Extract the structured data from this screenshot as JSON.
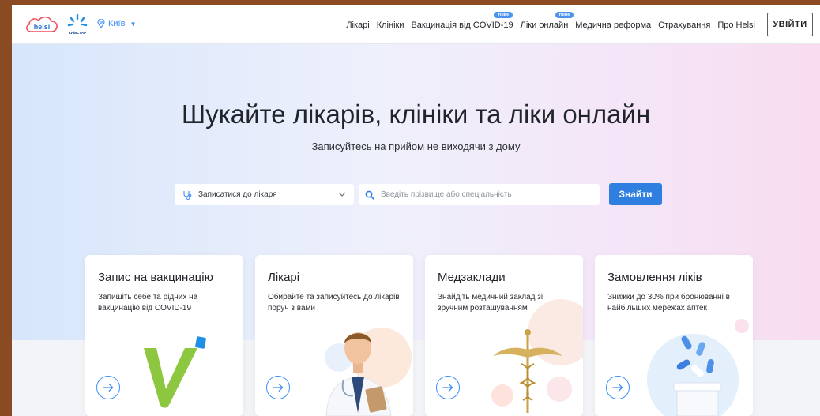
{
  "header": {
    "logo_text": "helsi",
    "partner_name": "КИЇВСТАР",
    "city": "Київ",
    "nav": [
      {
        "label": "Лікарі",
        "badge": ""
      },
      {
        "label": "Клініки",
        "badge": ""
      },
      {
        "label": "Вакцинація від COVID-19",
        "badge": "Нове"
      },
      {
        "label": "Ліки онлайн",
        "badge": "Нове"
      },
      {
        "label": "Медична реформа",
        "badge": ""
      },
      {
        "label": "Страхування",
        "badge": ""
      },
      {
        "label": "Про Helsi",
        "badge": ""
      }
    ],
    "login_label": "УВІЙТИ"
  },
  "hero": {
    "title": "Шукайте лікарів, клініки та ліки онлайн",
    "subtitle": "Записуйтесь на прийом не виходячи з дому"
  },
  "search": {
    "select_value": "Записатися до лікаря",
    "placeholder": "Введіть прізвище або спеціальність",
    "value": "",
    "button_label": "Знайти"
  },
  "cards": [
    {
      "title": "Запис на вакцинацію",
      "description": "Запишіть себе та рідних на вакцинацію від COVID-19"
    },
    {
      "title": "Лікарі",
      "description": "Обирайте та записуйтесь до лікарів поруч з вами"
    },
    {
      "title": "Медзаклади",
      "description": "Знайдіть медичний заклад зі зручним розташуванням"
    },
    {
      "title": "Замовлення ліків",
      "description": "Знижки до 30% при бронюванні в найбільших мережах аптек"
    }
  ],
  "colors": {
    "accent": "#2f7fe0",
    "link": "#3d8ef5",
    "text": "#21242a",
    "vaccine_green": "#8dc63f"
  }
}
